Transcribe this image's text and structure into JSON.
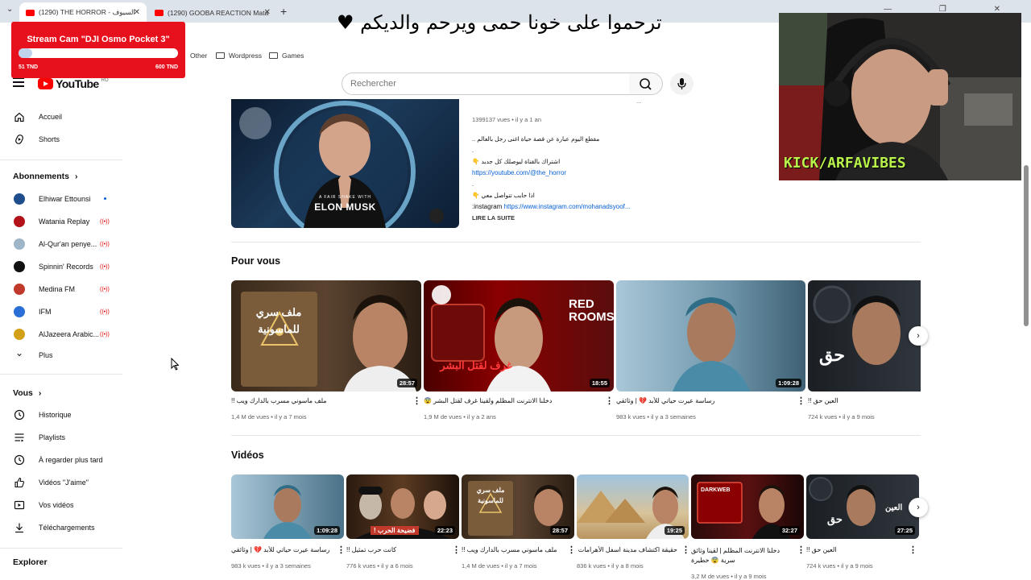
{
  "browser": {
    "tabs": [
      {
        "label": "(1290) THE HORROR - السيوف",
        "close": "✕"
      },
      {
        "label": "(1290) GOOBA REACTION Mata",
        "close": "✕"
      }
    ],
    "new_tab": "+",
    "tab_menu": "⌄",
    "window_controls": "— ❐ ✕"
  },
  "overlay_title": "ترحموا على خونا حمى ويرحم والديكم ♥",
  "stream_goal": {
    "title": "Stream Cam \"DJI Osmo Pocket 3\"",
    "min": "51 TND",
    "max": "600 TND",
    "progress": 0.085
  },
  "bookmarks": [
    "Other",
    "Wordpress",
    "Games"
  ],
  "webcam": {
    "watermark": "KICK/ARFAVIBES"
  },
  "header": {
    "logo": "YouTube",
    "country": "RO",
    "search_placeholder": "Rechercher"
  },
  "sidebar": {
    "home": "Accueil",
    "shorts": "Shorts",
    "subscriptions_title": "Abonnements",
    "subscriptions": [
      {
        "name": "Elhiwar Ettounsi",
        "status": "new",
        "color": "#1f4e8c"
      },
      {
        "name": "Watania Replay",
        "status": "live",
        "color": "#b3121a"
      },
      {
        "name": "Al-Qur'an penye...",
        "status": "live",
        "color": "#9fb6c9"
      },
      {
        "name": "Spinnin' Records",
        "status": "live",
        "color": "#111111"
      },
      {
        "name": "Medina FM",
        "status": "live",
        "color": "#c0392b"
      },
      {
        "name": "IFM",
        "status": "live",
        "color": "#2a6fd6"
      },
      {
        "name": "AlJazeera Arabic...",
        "status": "live",
        "color": "#d4a017"
      }
    ],
    "live_icon": "((•))",
    "more": "Plus",
    "you_title": "Vous",
    "you_items": [
      "Historique",
      "Playlists",
      "À regarder plus tard",
      "Vidéos \"J'aime\"",
      "Vos vidéos",
      "Téléchargements"
    ],
    "explore_title": "Explorer"
  },
  "featured": {
    "thumb_text_small": "A FAIR SHAKE WITH",
    "thumb_text": "ELON MUSK",
    "meta": "1399137 vues • il y a 1 an",
    "line_top": "...",
    "desc1": "مقطع اليوم عبارة عن قصة حياة اغنى رجل بالعالم ..",
    "dot1": ".",
    "desc2": "👇 اشتراك بالقناة ليوصلك كل جديد",
    "link1": "https://youtube.com/@the_horror",
    "dot2": ".",
    "desc3": "👇 اذا حابب تتواصل معي",
    "insta_label": ":instagram",
    "link2": "https://www.instagram.com/mohanadsyoof...",
    "read_more": "LIRE LA SUITE"
  },
  "for_you": {
    "title": "Pour vous",
    "videos": [
      {
        "title": "ملف ماسوني مسرب بالدارك ويب !!",
        "meta": "1,4 M de vues • il y a 7 mois",
        "duration": "28:57",
        "thumb_text": "ملف سري للماسونية"
      },
      {
        "title": "دخلنا الانترنت المظلم ولقينا غرف لقتل البشر 😨",
        "meta": "1,9 M de vues • il y a 2 ans",
        "duration": "18:55",
        "thumb_text": "غرف لقتل البشر",
        "thumb_text2": "RED ROOMS"
      },
      {
        "title": "رساسة عيرت حياتي للأبد 💔 | وثائقي",
        "meta": "983 k vues • il y a 3 semaines",
        "duration": "1:09:28"
      },
      {
        "title": "العين حق !!",
        "meta": "724 k vues • il y a 9 mois",
        "thumb_text": "حق"
      }
    ]
  },
  "videos": {
    "title": "Vidéos",
    "items": [
      {
        "title": "رساسة عيرت حياتي للأبد 💔 | وثائقي",
        "meta": "983 k vues • il y a 3 semaines",
        "duration": "1:09:28"
      },
      {
        "title": "كانت حرب تمثيل !!",
        "meta": "776 k vues • il y a 6 mois",
        "duration": "22:23",
        "thumb_text": "فضيحة الحرب !"
      },
      {
        "title": "ملف ماسوني مسرب بالدارك ويب !!",
        "meta": "1,4 M de vues • il y a 7 mois",
        "duration": "28:57",
        "thumb_text": "ملف سري للماسونية"
      },
      {
        "title": "حقيقة اكتشاف مدينة اسفل الأهرامات !!",
        "meta": "836 k vues • il y a 8 mois",
        "duration": "19:25"
      },
      {
        "title": "دخلنا الانترنت المظلم | لقينا وثائق سرية 😨 خطيرة",
        "meta": "3,2 M de vues • il y a 9 mois",
        "duration": "32:27",
        "thumb_text": "DARKWEB"
      },
      {
        "title": "العين حق !!",
        "meta": "724 k vues • il y a 9 mois",
        "duration": "27:25",
        "thumb_text": "حق",
        "thumb_text2": "العين"
      }
    ]
  },
  "icons": {
    "kebab": "⋮",
    "next": "›",
    "chevron_right": "›",
    "chevron_down": "⌄"
  }
}
